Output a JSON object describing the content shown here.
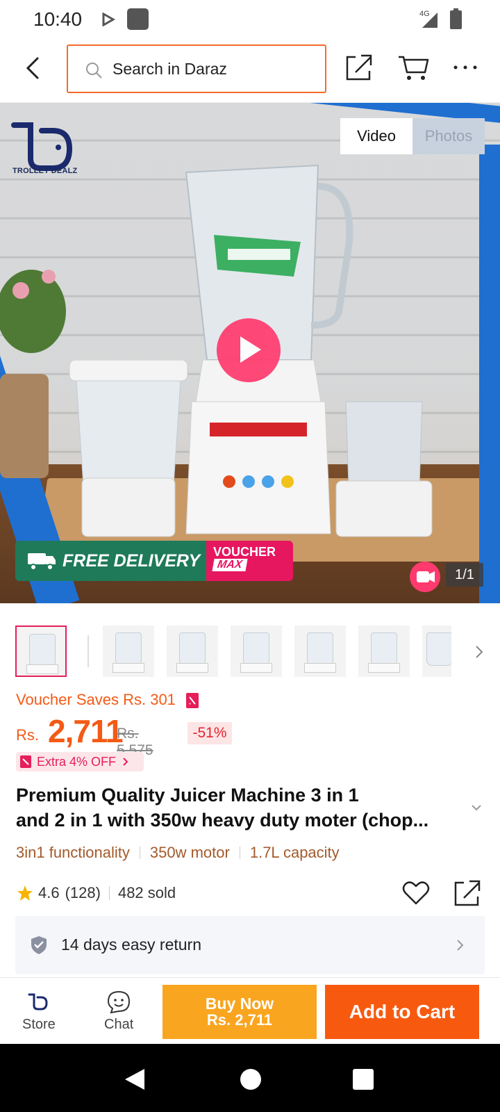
{
  "status_bar": {
    "time": "10:40",
    "network": "4G"
  },
  "header": {
    "search_placeholder": "Search in Daraz"
  },
  "hero": {
    "brand_name": "TROLLEY DEALZ",
    "tabs": [
      {
        "label": "Video",
        "active": true
      },
      {
        "label": "Photos",
        "active": false
      }
    ],
    "promo": {
      "free_delivery": "FREE DELIVERY",
      "voucher_line1": "VOUCHER",
      "voucher_line2": "MAX"
    },
    "page_indicator": "1/1"
  },
  "thumbnails": {
    "count": 7,
    "selected_index": 0
  },
  "product": {
    "voucher_saves": "Voucher Saves Rs. 301",
    "price_currency": "Rs.",
    "price_value": "2,711",
    "price_original": "Rs. 5,575",
    "discount": "-51%",
    "extra_offer": "Extra 4% OFF",
    "title_line1": "Premium Quality Juicer Machine 3 in 1",
    "title_line2": "and 2 in 1 with 350w heavy duty moter (chop...",
    "features": [
      "3in1 functionality",
      "350w motor",
      "1.7L capacity"
    ],
    "rating": "4.6",
    "rating_count": "(128)",
    "sold": "482 sold",
    "return_policy": "14 days easy return"
  },
  "action_bar": {
    "store_label": "Store",
    "chat_label": "Chat",
    "buy_now_line1": "Buy Now",
    "buy_now_line2": "Rs. 2,711",
    "add_to_cart": "Add to Cart"
  },
  "colors": {
    "accent_orange": "#f75a0f",
    "buy_yellow": "#f9a51f",
    "price_orange": "#f35a15",
    "pink": "#e61e5a",
    "feature_brown": "#a35a2b"
  },
  "icons": [
    "back-icon",
    "search-icon",
    "share-icon",
    "cart-icon",
    "more-icon",
    "play-icon",
    "video-icon",
    "chevron-right-icon",
    "chevron-down-icon",
    "star-icon",
    "heart-icon",
    "shield-icon",
    "store-icon",
    "chat-icon"
  ]
}
